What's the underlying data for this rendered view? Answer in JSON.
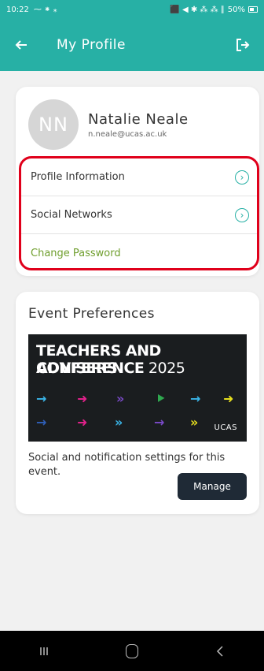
{
  "status_bar": {
    "time": "10:22",
    "left_icons": "⁓ ⁕ ⁎",
    "right_icons": "⬛ ◀ ✱ ⁂ ⁂ ∥ ",
    "battery": "50%"
  },
  "header": {
    "title": "My Profile",
    "back_icon": "arrow-left-icon",
    "logout_icon": "logout-icon"
  },
  "profile": {
    "initials": "NN",
    "name": "Natalie Neale",
    "email": "n.neale@ucas.ac.uk"
  },
  "menu": {
    "items": [
      {
        "label": "Profile Information",
        "icon": "chevron-circle-icon",
        "glyph": "›"
      },
      {
        "label": "Social Networks",
        "icon": "chevron-circle-icon",
        "glyph": "›"
      },
      {
        "label": "Change Password"
      }
    ]
  },
  "events": {
    "title": "Event Preferences",
    "banner": {
      "line1": "TEACHERS AND ADVISERS",
      "line2a": "CONFERENCE",
      "line2b": " 2025",
      "logo": "UCAS"
    },
    "description": "Social and notification settings for this event.",
    "manage_label": "Manage"
  },
  "colors": {
    "accent": "#27b0a5",
    "highlight_border": "#e0001b",
    "password_link": "#6f9e2d",
    "button_dark": "#1f2a36"
  }
}
